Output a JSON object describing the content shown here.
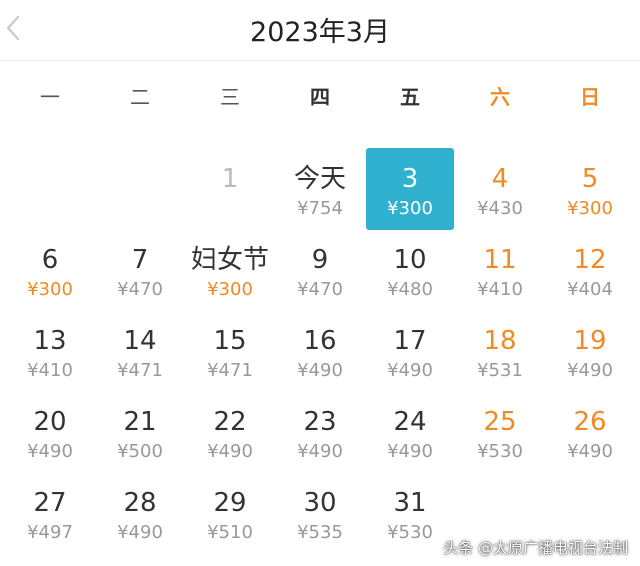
{
  "header": {
    "title": "2023年3月",
    "back_icon": "chevron-left-icon"
  },
  "weekdays": [
    "一",
    "二",
    "三",
    "四",
    "五",
    "六",
    "日"
  ],
  "colors": {
    "accent_orange": "#f08a24",
    "selected_bg": "#2fb1cf",
    "text_dark": "#333333",
    "text_gray": "#999999"
  },
  "calendar": {
    "weeks": [
      [
        null,
        null,
        {
          "day": "1",
          "price": "",
          "state": "past"
        },
        {
          "day": "今天",
          "price": "¥754",
          "state": "today"
        },
        {
          "day": "3",
          "price": "¥300",
          "state": "selected"
        },
        {
          "day": "4",
          "price": "¥430",
          "state": "weekend"
        },
        {
          "day": "5",
          "price": "¥300",
          "state": "weekend-cheap"
        }
      ],
      [
        {
          "day": "6",
          "price": "¥300",
          "state": "cheap"
        },
        {
          "day": "7",
          "price": "¥470",
          "state": "normal"
        },
        {
          "day": "妇女节",
          "price": "¥300",
          "state": "cheap"
        },
        {
          "day": "9",
          "price": "¥470",
          "state": "normal"
        },
        {
          "day": "10",
          "price": "¥480",
          "state": "normal"
        },
        {
          "day": "11",
          "price": "¥410",
          "state": "weekend"
        },
        {
          "day": "12",
          "price": "¥404",
          "state": "weekend"
        }
      ],
      [
        {
          "day": "13",
          "price": "¥410",
          "state": "normal"
        },
        {
          "day": "14",
          "price": "¥471",
          "state": "normal"
        },
        {
          "day": "15",
          "price": "¥471",
          "state": "normal"
        },
        {
          "day": "16",
          "price": "¥490",
          "state": "normal"
        },
        {
          "day": "17",
          "price": "¥490",
          "state": "normal"
        },
        {
          "day": "18",
          "price": "¥531",
          "state": "weekend"
        },
        {
          "day": "19",
          "price": "¥490",
          "state": "weekend"
        }
      ],
      [
        {
          "day": "20",
          "price": "¥490",
          "state": "normal"
        },
        {
          "day": "21",
          "price": "¥500",
          "state": "normal"
        },
        {
          "day": "22",
          "price": "¥490",
          "state": "normal"
        },
        {
          "day": "23",
          "price": "¥490",
          "state": "normal"
        },
        {
          "day": "24",
          "price": "¥490",
          "state": "normal"
        },
        {
          "day": "25",
          "price": "¥530",
          "state": "weekend"
        },
        {
          "day": "26",
          "price": "¥490",
          "state": "weekend"
        }
      ],
      [
        {
          "day": "27",
          "price": "¥497",
          "state": "normal"
        },
        {
          "day": "28",
          "price": "¥490",
          "state": "normal"
        },
        {
          "day": "29",
          "price": "¥510",
          "state": "normal"
        },
        {
          "day": "30",
          "price": "¥535",
          "state": "normal"
        },
        {
          "day": "31",
          "price": "¥530",
          "state": "normal"
        },
        null,
        null
      ]
    ]
  },
  "watermark": "头条 @太原广播电视台法制"
}
